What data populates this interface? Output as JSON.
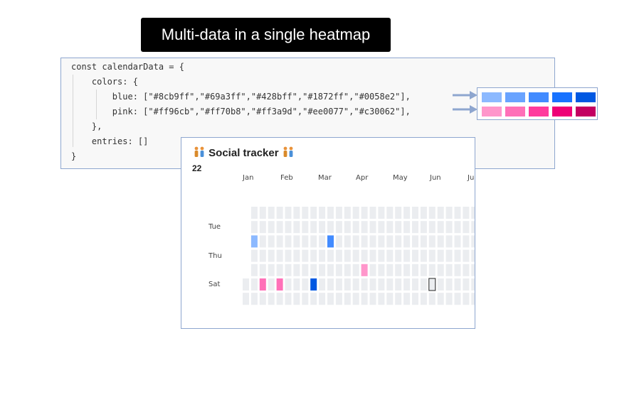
{
  "page_title": "Multi-data in a single heatmap",
  "code": {
    "lines": [
      "const calendarData = {",
      "    colors: {",
      "        blue: [\"#8cb9ff\",\"#69a3ff\",\"#428bff\",\"#1872ff\",\"#0058e2\"],",
      "        pink: [\"#ff96cb\",\"#ff70b8\",\"#ff3a9d\",\"#ee0077\",\"#c30062\"],",
      "    },",
      "    entries: []",
      "}"
    ]
  },
  "palette": {
    "blue": [
      "#8cb9ff",
      "#69a3ff",
      "#428bff",
      "#1872ff",
      "#0058e2"
    ],
    "pink": [
      "#ff96cb",
      "#ff70b8",
      "#ff3a9d",
      "#ee0077",
      "#c30062"
    ]
  },
  "tracker": {
    "title": "Social tracker",
    "icon": "people-icon",
    "year": "22",
    "months": [
      "Jan",
      "Feb",
      "Mar",
      "Apr",
      "May",
      "Jun",
      "Ju"
    ],
    "day_labels": {
      "tue": "Tue",
      "thu": "Thu",
      "sat": "Sat"
    },
    "empty_color": "#ebedf0",
    "cells": [
      {
        "week": 1,
        "day": 2,
        "color": "#8cb9ff"
      },
      {
        "week": 10,
        "day": 2,
        "color": "#428bff"
      },
      {
        "week": 14,
        "day": 4,
        "color": "#ff96cb"
      },
      {
        "week": 2,
        "day": 5,
        "color": "#ff70b8"
      },
      {
        "week": 4,
        "day": 5,
        "color": "#ff70b8"
      },
      {
        "week": 8,
        "day": 5,
        "color": "#0058e2"
      }
    ],
    "selected_cell": {
      "week": 22,
      "day": 5
    }
  }
}
